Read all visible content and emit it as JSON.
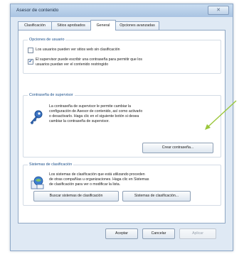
{
  "window": {
    "title": "Asesor de contenido",
    "close_glyph": "✕"
  },
  "tabs": [
    {
      "label": "Clasificación"
    },
    {
      "label": "Sitios aprobados"
    },
    {
      "label": "General"
    },
    {
      "label": "Opciones avanzadas"
    }
  ],
  "user_options": {
    "title": "Opciones de usuario",
    "option1": {
      "label": "Los usuarios pueden ver sitios web sin clasificación",
      "checked": false
    },
    "option2": {
      "label_line1": "El supervisor puede escribir una contraseña para permitir que los",
      "label_line2": "usuarios puedan ver el contenido restringido",
      "checked": true,
      "check_glyph": "✔"
    }
  },
  "supervisor": {
    "title": "Contraseña de supervisor",
    "desc": [
      "La contraseña de supervisor le permite cambiar la",
      "configuración de Asesor de contenido, así como activarlo",
      "o desactivarlo. Haga clic en el siguiente botón si desea",
      "cambiar la contraseña de supervisor."
    ],
    "icon": "key-icon",
    "button": "Crear contraseña..."
  },
  "rating": {
    "title": "Sistemas de clasificación",
    "desc": [
      "Los sistemas de clasificación que está utilizando proceden",
      "de otras compañías u organizaciones. Haga clic en Sistemas",
      "de clasificación para ver o modificar la lista."
    ],
    "icon": "rating-systems-icon",
    "find_button": "Buscar sistemas de clasificación",
    "systems_button": "Sistemas de clasificación..."
  },
  "footer": {
    "ok": "Aceptar",
    "cancel": "Cancelar",
    "apply": "Aplicar"
  },
  "colors": {
    "annotation_arrow": "#9bc73b",
    "accent_title": "#1a4f8a"
  }
}
